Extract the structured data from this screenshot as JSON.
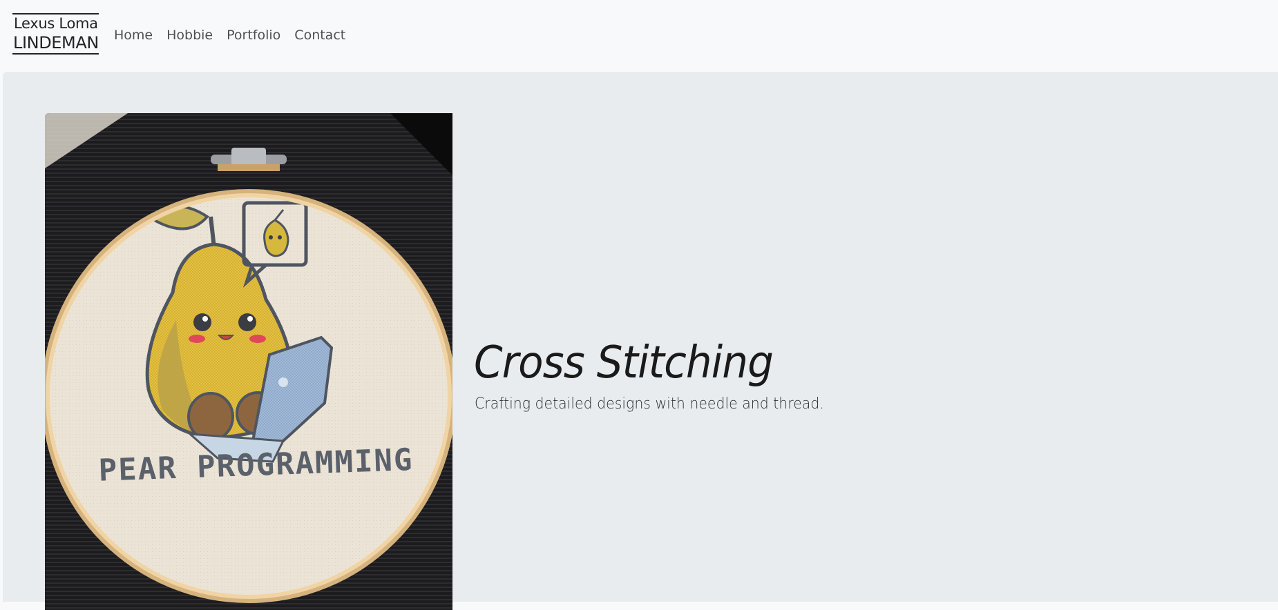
{
  "navbar": {
    "brand": {
      "first_name": "Lexus Loma",
      "last_name": "LINDEMAN"
    },
    "links": [
      {
        "label": "Home"
      },
      {
        "label": "Hobbie"
      },
      {
        "label": "Portfolio"
      },
      {
        "label": "Contact"
      }
    ]
  },
  "hero": {
    "title": "Cross Stitching",
    "subtitle": "Crafting detailed designs with needle and thread.",
    "image": {
      "embroidered_text": "PEAR PROGRAMMING"
    }
  },
  "colors": {
    "navbar_bg": "#f8f9fa",
    "main_bg": "#e9ecef",
    "text": "#212529",
    "hoop": "#e2c392",
    "fabric": "#ece6d8",
    "pear": "#e8c84a",
    "laptop": "#a9c0dc"
  }
}
